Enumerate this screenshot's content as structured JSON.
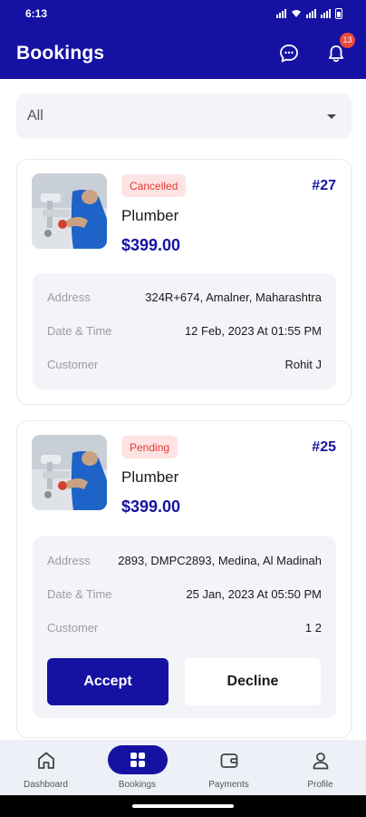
{
  "status_bar": {
    "time": "6:13"
  },
  "header": {
    "title": "Bookings",
    "notification_count": "13"
  },
  "filter": {
    "selected": "All"
  },
  "address_label": "Address",
  "datetime_label": "Date & Time",
  "customer_label": "Customer",
  "bookings": [
    {
      "status": "Cancelled",
      "id": "#27",
      "service": "Plumber",
      "price": "$399.00",
      "address": "324R+674, Amalner, Maharashtra",
      "datetime": "12 Feb, 2023 At 01:55 PM",
      "customer": "Rohit J"
    },
    {
      "status": "Pending",
      "id": "#25",
      "service": "Plumber",
      "price": "$399.00",
      "address": "2893, DMPC2893, Medina, Al Madinah",
      "datetime": "25 Jan, 2023 At 05:50 PM",
      "customer": "1 2",
      "accept_label": "Accept",
      "decline_label": "Decline"
    }
  ],
  "nav": [
    {
      "label": "Dashboard",
      "icon": "home-icon"
    },
    {
      "label": "Bookings",
      "icon": "bookings-icon"
    },
    {
      "label": "Payments",
      "icon": "wallet-icon"
    },
    {
      "label": "Profile",
      "icon": "profile-icon"
    }
  ],
  "colors": {
    "primary": "#1512a3",
    "cancelled": "#e53935",
    "badge": "#e84b3c"
  }
}
